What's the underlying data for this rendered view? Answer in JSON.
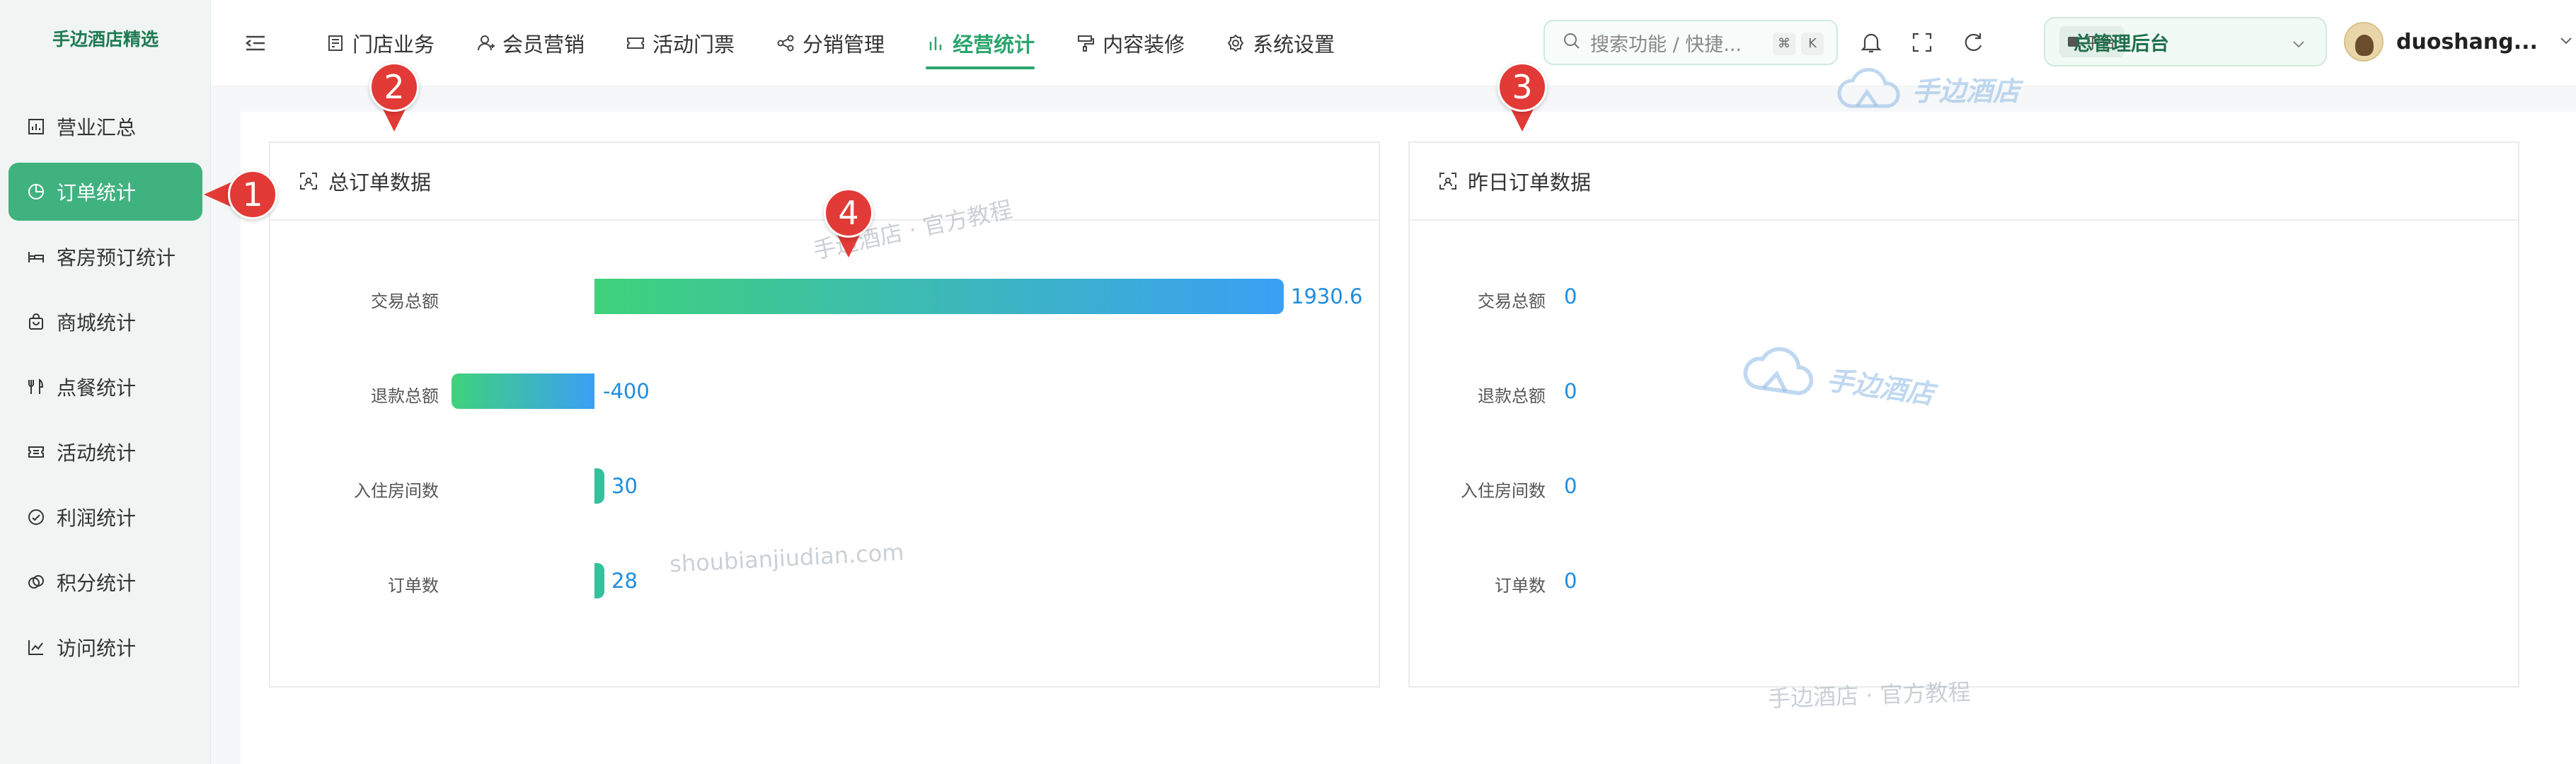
{
  "app": {
    "logo_text": "手边酒店精选"
  },
  "sidebar": {
    "items": [
      {
        "label": "营业汇总",
        "icon": "bar-report-icon"
      },
      {
        "label": "订单统计",
        "icon": "pie-chart-icon",
        "active": true
      },
      {
        "label": "客房预订统计",
        "icon": "bed-icon"
      },
      {
        "label": "商城统计",
        "icon": "shopping-bag-icon"
      },
      {
        "label": "点餐统计",
        "icon": "cutlery-icon"
      },
      {
        "label": "活动统计",
        "icon": "ticket-icon"
      },
      {
        "label": "利润统计",
        "icon": "check-circle-icon"
      },
      {
        "label": "积分统计",
        "icon": "coins-icon"
      },
      {
        "label": "访问统计",
        "icon": "line-chart-icon"
      }
    ]
  },
  "topnav": {
    "items": [
      {
        "label": "门店业务",
        "icon": "store-icon"
      },
      {
        "label": "会员营销",
        "icon": "user-icon"
      },
      {
        "label": "活动门票",
        "icon": "ticket-icon"
      },
      {
        "label": "分销管理",
        "icon": "share-icon"
      },
      {
        "label": "经营统计",
        "icon": "stats-icon",
        "active": true
      },
      {
        "label": "内容装修",
        "icon": "paint-roller-icon"
      },
      {
        "label": "系统设置",
        "icon": "gear-icon"
      }
    ]
  },
  "search": {
    "placeholder": "搜索功能 / 快捷...",
    "key1": "⌘",
    "key2": "K"
  },
  "platform": {
    "tag": "平台",
    "value": "总管理后台"
  },
  "user": {
    "name": "duoshang..."
  },
  "cards": {
    "total": {
      "title": "总订单数据",
      "rows": [
        {
          "label": "交易总额",
          "value": "1930.6"
        },
        {
          "label": "退款总额",
          "value": "-400"
        },
        {
          "label": "入住房间数",
          "value": "30"
        },
        {
          "label": "订单数",
          "value": "28"
        }
      ]
    },
    "yesterday": {
      "title": "昨日订单数据",
      "rows": [
        {
          "label": "交易总额",
          "value": "0"
        },
        {
          "label": "退款总额",
          "value": "0"
        },
        {
          "label": "入住房间数",
          "value": "0"
        },
        {
          "label": "订单数",
          "value": "0"
        }
      ]
    }
  },
  "watermarks": {
    "logo": "手边酒店",
    "t1": "手边酒店 · 官方教程",
    "t2": "shoubianjiudian.com",
    "t3": "手边酒店 · 官方教程"
  },
  "callouts": [
    "1",
    "2",
    "3",
    "4"
  ],
  "colors": {
    "accent": "#3fb27f",
    "value_blue": "#1f8de0",
    "callout_red": "#e23a36"
  }
}
